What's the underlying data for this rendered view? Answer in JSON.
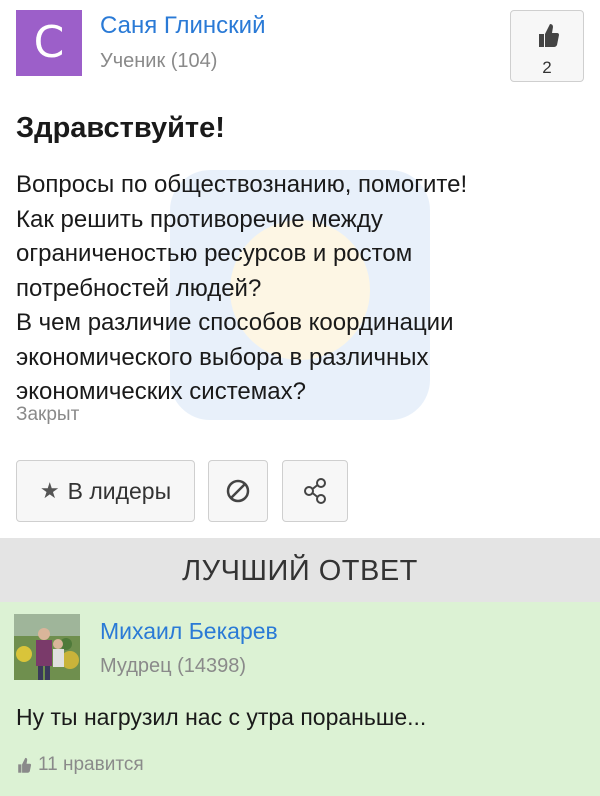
{
  "question": {
    "author": {
      "avatar_letter": "С",
      "name": "Саня Глинский",
      "rank": "Ученик (104)"
    },
    "like_count": "2",
    "title": "Здравствуйте!",
    "text": "Вопросы по обществознанию, помогите!\nКак решить противоречие между\nограниченостью ресурсов и ростом\nпотребностей людей?\nВ чем различие способов координации\nэкономического выбора в различных\nэкономических системах?",
    "status": "Закрыт"
  },
  "actions": {
    "leaders_label": "В лидеры",
    "leaders_icon": "star-icon",
    "block_icon": "block-icon",
    "share_icon": "share-icon"
  },
  "best_answer": {
    "header": "ЛУЧШИЙ ОТВЕТ",
    "author": {
      "name": "Михаил Бекарев",
      "rank": "Мудрец (14398)"
    },
    "text": "Ну ты нагрузил нас с утра пораньше...",
    "likes_label": "11 нравится"
  },
  "colors": {
    "accent_link": "#2a7ad6",
    "avatar_purple": "#9c5fc9",
    "answer_bg": "#dcf2d4",
    "band_bg": "#e4e4e4"
  }
}
